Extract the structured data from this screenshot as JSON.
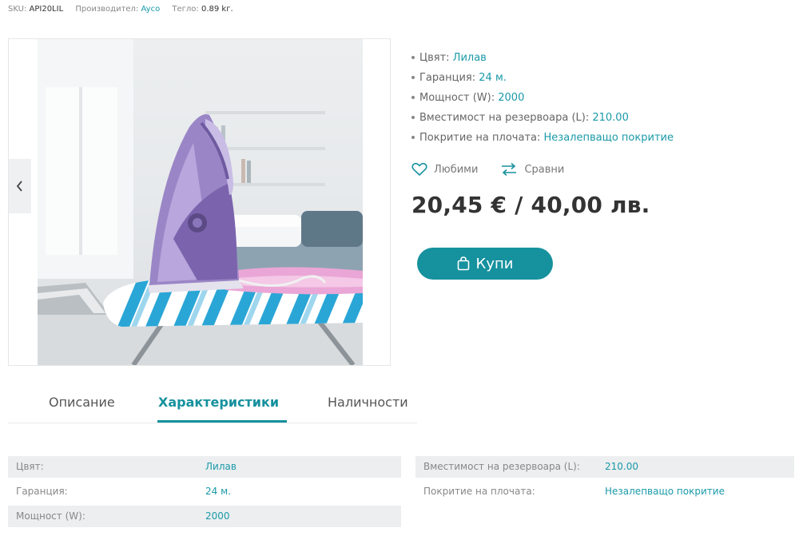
{
  "meta": {
    "sku_label": "SKU:",
    "sku_value": "API20LIL",
    "manufacturer_label": "Производител:",
    "manufacturer_value": "Ayco",
    "weight_label": "Тегло:",
    "weight_value": "0.89 kг."
  },
  "specs": [
    {
      "label": "Цвят:",
      "value": "Лилав"
    },
    {
      "label": "Гаранция:",
      "value": "24 м."
    },
    {
      "label": "Мощност (W):",
      "value": "2000"
    },
    {
      "label": "Вместимост на резервоара (L):",
      "value": "210.00"
    },
    {
      "label": "Покритие на плочата:",
      "value": "Незалепващо покритие"
    }
  ],
  "actions": {
    "favorites": "Любими",
    "compare": "Сравни"
  },
  "price": "20,45 € / 40,00 лв.",
  "buy_label": "Купи",
  "tabs": [
    {
      "label": "Описание"
    },
    {
      "label": "Характеристики"
    },
    {
      "label": "Наличности"
    }
  ],
  "table_left": [
    {
      "label": "Цвят:",
      "value": "Лилав"
    },
    {
      "label": "Гаранция:",
      "value": "24 м."
    },
    {
      "label": "Мощност (W):",
      "value": "2000"
    }
  ],
  "table_right": [
    {
      "label": "Вместимост на резервоара (L):",
      "value": "210.00"
    },
    {
      "label": "Покритие на плочата:",
      "value": "Незалепващо покритие"
    }
  ],
  "colors": {
    "accent": "#16919e",
    "link": "#1a9aa8",
    "row_shade": "#eceeef"
  },
  "icons": {
    "prev": "chevron-left-icon",
    "favorites": "heart-icon",
    "compare": "compare-arrows-icon",
    "buy": "shopping-bag-icon"
  }
}
